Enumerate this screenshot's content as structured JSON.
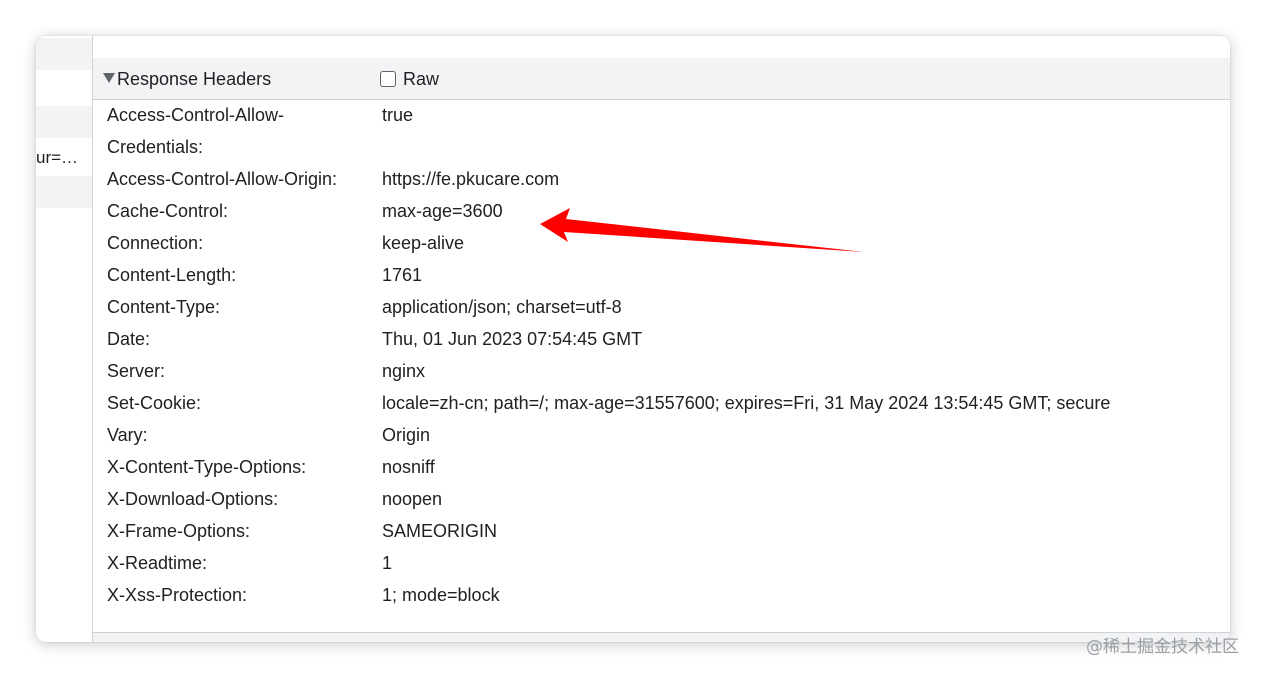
{
  "left_pane": {
    "truncated_text": "ur=…"
  },
  "section": {
    "title": "Response Headers",
    "raw_label": "Raw",
    "raw_checked": false
  },
  "headers": [
    {
      "name": "Access-Control-Allow-Credentials:",
      "value": "true"
    },
    {
      "name": "Access-Control-Allow-Origin:",
      "value": "https://fe.pkucare.com"
    },
    {
      "name": "Cache-Control:",
      "value": "max-age=3600"
    },
    {
      "name": "Connection:",
      "value": "keep-alive"
    },
    {
      "name": "Content-Length:",
      "value": "1761"
    },
    {
      "name": "Content-Type:",
      "value": "application/json; charset=utf-8"
    },
    {
      "name": "Date:",
      "value": "Thu, 01 Jun 2023 07:54:45 GMT"
    },
    {
      "name": "Server:",
      "value": "nginx"
    },
    {
      "name": "Set-Cookie:",
      "value": "locale=zh-cn; path=/; max-age=31557600; expires=Fri, 31 May 2024 13:54:45 GMT; secure"
    },
    {
      "name": "Vary:",
      "value": "Origin"
    },
    {
      "name": "X-Content-Type-Options:",
      "value": "nosniff"
    },
    {
      "name": "X-Download-Options:",
      "value": "noopen"
    },
    {
      "name": "X-Frame-Options:",
      "value": "SAMEORIGIN"
    },
    {
      "name": "X-Readtime:",
      "value": "1"
    },
    {
      "name": "X-Xss-Protection:",
      "value": "1; mode=block"
    }
  ],
  "annotation": {
    "arrow_color": "#ff0000"
  },
  "watermark": "@稀土掘金技术社区"
}
